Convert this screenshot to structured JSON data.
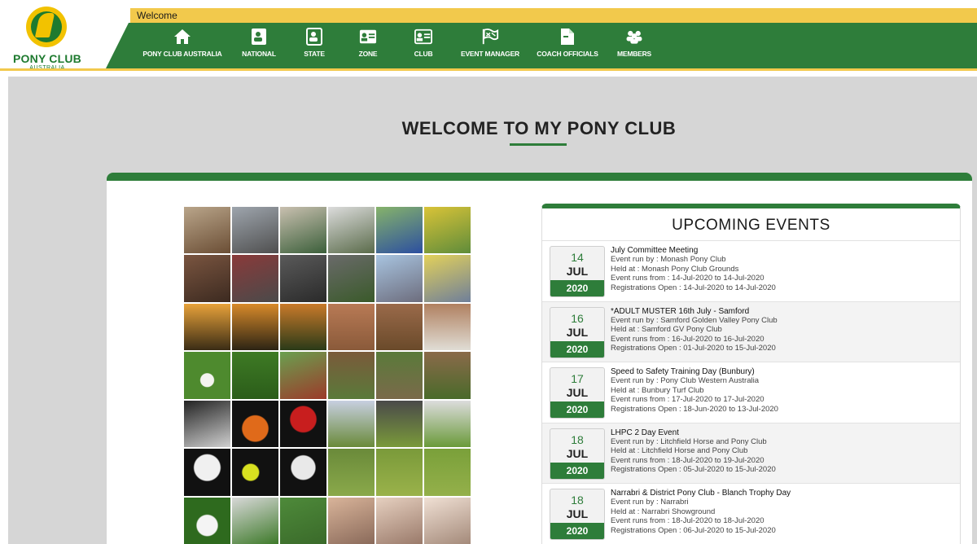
{
  "logo": {
    "title": "PONY CLUB",
    "subtitle": "AUSTRALIA"
  },
  "welcome_label": "Welcome",
  "nav": [
    {
      "label": "PONY CLUB AUSTRALIA",
      "icon": "home-icon"
    },
    {
      "label": "NATIONAL",
      "icon": "contact-card-icon"
    },
    {
      "label": "STATE",
      "icon": "contact-card-icon"
    },
    {
      "label": "ZONE",
      "icon": "id-card-icon"
    },
    {
      "label": "CLUB",
      "icon": "id-card-icon"
    },
    {
      "label": "EVENT MANAGER",
      "icon": "flag-icon"
    },
    {
      "label": "COACH OFFICIALS",
      "icon": "document-icon"
    },
    {
      "label": "MEMBERS",
      "icon": "group-icon"
    }
  ],
  "page_title": "WELCOME TO MY PONY CLUB",
  "events_title": "UPCOMING EVENTS",
  "events": [
    {
      "day": "14",
      "month": "JUL",
      "year": "2020",
      "title": "July Committee Meeting",
      "run_by": "Event run by : Monash Pony Club",
      "held_at": "Held at : Monash Pony Club Grounds",
      "runs": "Event runs from : 14-Jul-2020 to 14-Jul-2020",
      "registrations": "Registrations Open : 14-Jul-2020 to 14-Jul-2020"
    },
    {
      "day": "16",
      "month": "JUL",
      "year": "2020",
      "title": "*ADULT MUSTER 16th July - Samford",
      "run_by": "Event run by : Samford Golden Valley Pony Club",
      "held_at": "Held at : Samford GV Pony Club",
      "runs": "Event runs from : 16-Jul-2020 to 16-Jul-2020",
      "registrations": "Registrations Open : 01-Jul-2020 to 15-Jul-2020"
    },
    {
      "day": "17",
      "month": "JUL",
      "year": "2020",
      "title": "Speed to Safety Training Day (Bunbury)",
      "run_by": "Event run by : Pony Club Western Australia",
      "held_at": "Held at : Bunbury Turf Club",
      "runs": "Event runs from : 17-Jul-2020 to 17-Jul-2020",
      "registrations": "Registrations Open : 18-Jun-2020 to 13-Jul-2020"
    },
    {
      "day": "18",
      "month": "JUL",
      "year": "2020",
      "title": "LHPC 2 Day Event",
      "run_by": "Event run by : Litchfield Horse and Pony Club",
      "held_at": "Held at : Litchfield Horse and Pony Club",
      "runs": "Event runs from : 18-Jul-2020 to 19-Jul-2020",
      "registrations": "Registrations Open : 05-Jul-2020 to 15-Jul-2020"
    },
    {
      "day": "18",
      "month": "JUL",
      "year": "2020",
      "title": "Narrabri & District Pony Club - Blanch Trophy Day",
      "run_by": "Event run by : Narrabri",
      "held_at": "Held at : Narrabri Showground",
      "runs": "Event runs from : 18-Jul-2020 to 18-Jul-2020",
      "registrations": "Registrations Open : 06-Jul-2020 to 15-Jul-2020"
    }
  ],
  "colors": {
    "brand_green": "#2e7d3a",
    "brand_yellow": "#f2c94c",
    "background": "#d6d6d6"
  }
}
